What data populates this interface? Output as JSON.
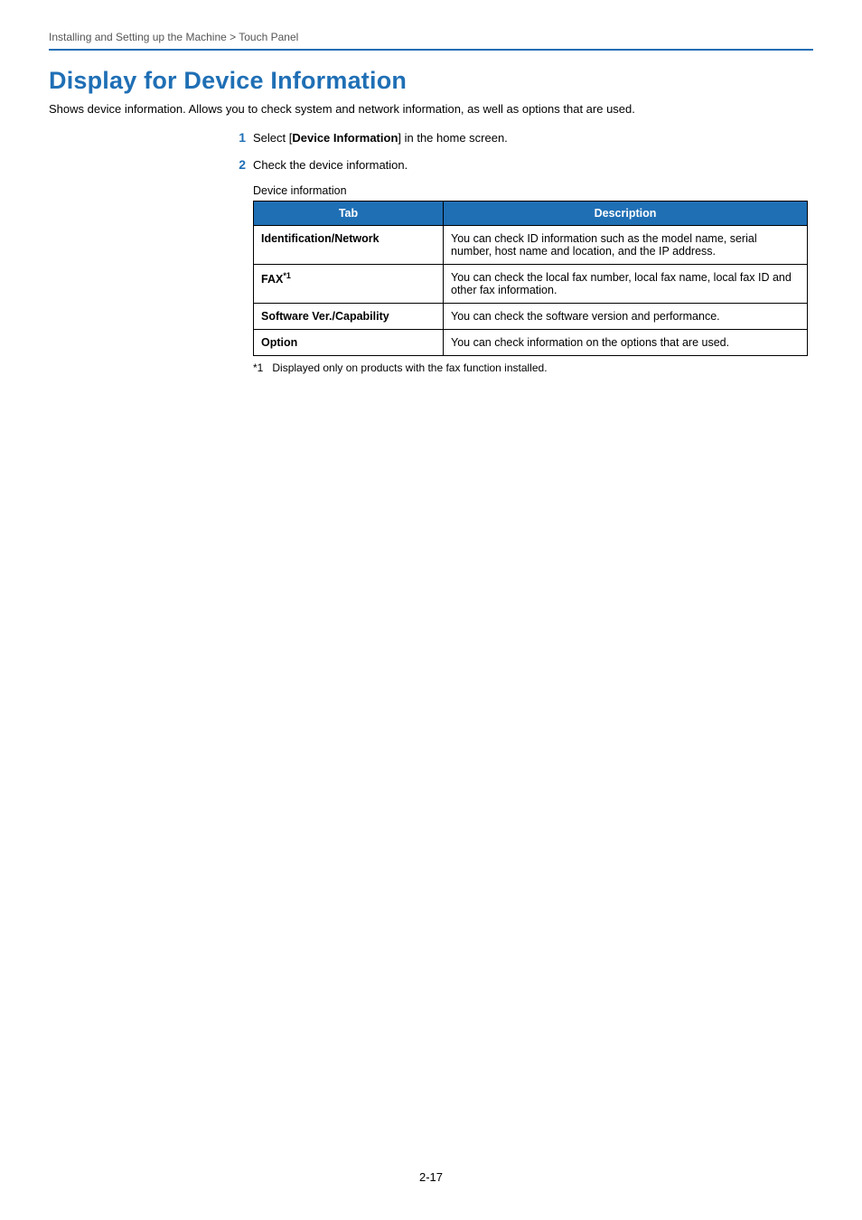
{
  "breadcrumb": "Installing and Setting up the Machine > Touch Panel",
  "title": "Display for Device Information",
  "intro": "Shows device information. Allows you to check system and network information, as well as options that are used.",
  "step1": {
    "num": "1",
    "prefix": "Select [",
    "bold": "Device Information",
    "suffix": "] in the home screen."
  },
  "step2": {
    "num": "2",
    "text": "Check the device information."
  },
  "table_caption": "Device information",
  "headers": {
    "tab": "Tab",
    "desc": "Description"
  },
  "rows": {
    "r1": {
      "tab": "Identification/Network",
      "desc": "You can check ID information such as the model name, serial number, host name and location, and the IP address."
    },
    "r2": {
      "tab_prefix": "FAX",
      "tab_sup": "*1",
      "desc": "You can check the local fax number, local fax name, local fax ID and other fax information."
    },
    "r3": {
      "tab": "Software Ver./Capability",
      "desc": "You can check the software version and performance."
    },
    "r4": {
      "tab": "Option",
      "desc": "You can check information on the options that are used."
    }
  },
  "footnote": {
    "mark": "*1",
    "text": "Displayed only on products with the fax function installed."
  },
  "pagenum": "2-17"
}
